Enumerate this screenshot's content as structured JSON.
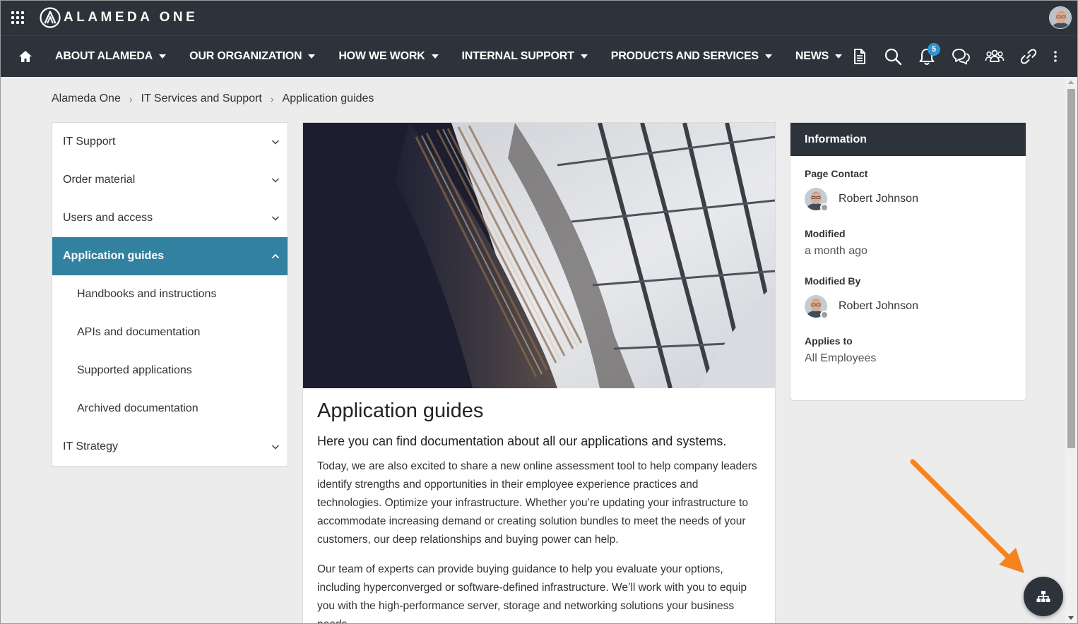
{
  "app": {
    "logo_text": "ALAMEDA ONE"
  },
  "nav": {
    "items": [
      {
        "label": "ABOUT ALAMEDA"
      },
      {
        "label": "OUR ORGANIZATION"
      },
      {
        "label": "HOW WE WORK"
      },
      {
        "label": "INTERNAL SUPPORT"
      },
      {
        "label": "PRODUCTS AND SERVICES"
      },
      {
        "label": "NEWS"
      }
    ],
    "tools": [
      "document-icon",
      "search-icon",
      "bell-icon",
      "chat-icon",
      "people-icon",
      "link-icon",
      "more-vertical-icon"
    ],
    "notification_count": "5"
  },
  "breadcrumb": {
    "items": [
      "Alameda One",
      "IT Services and Support",
      "Application guides"
    ],
    "separator": "›"
  },
  "leftnav": {
    "items": [
      {
        "label": "IT Support",
        "state": "collapsed"
      },
      {
        "label": "Order material",
        "state": "collapsed"
      },
      {
        "label": "Users and access",
        "state": "collapsed"
      },
      {
        "label": "Application guides",
        "state": "expanded-active"
      },
      {
        "label": "Handbooks and instructions",
        "level": 2
      },
      {
        "label": "APIs and documentation",
        "level": 2
      },
      {
        "label": "Supported applications",
        "level": 2
      },
      {
        "label": "Archived documentation",
        "level": 2
      },
      {
        "label": "IT Strategy",
        "state": "collapsed"
      }
    ]
  },
  "article": {
    "title": "Application guides",
    "lead": "Here you can find documentation about all our applications and systems.",
    "paragraphs": [
      "Today, we are also excited to share a new online assessment tool to help company leaders identify strengths and opportunities in their employee experience practices and technologies. Optimize your infrastructure. Whether you’re updating your infrastructure to accommodate increasing demand or creating solution bundles to meet the needs of your customers, our deep relationships and buying power can help.",
      "Our team of experts can provide buying guidance to help you evaluate your options, including hyperconverged or software-defined infrastructure. We’ll work with you to equip you with the high-performance server, storage and networking solutions your business needs."
    ]
  },
  "info": {
    "header": "Information",
    "page_contact_label": "Page Contact",
    "page_contact_name": "Robert Johnson",
    "modified_label": "Modified",
    "modified_value": "a month ago",
    "modified_by_label": "Modified By",
    "modified_by_name": "Robert Johnson",
    "applies_to_label": "Applies to",
    "applies_to_value": "All Employees"
  },
  "colors": {
    "topbar": "#2c333a",
    "active_nav": "#3381a0",
    "badge": "#2d93d4",
    "annotation_arrow": "#f5841f"
  }
}
